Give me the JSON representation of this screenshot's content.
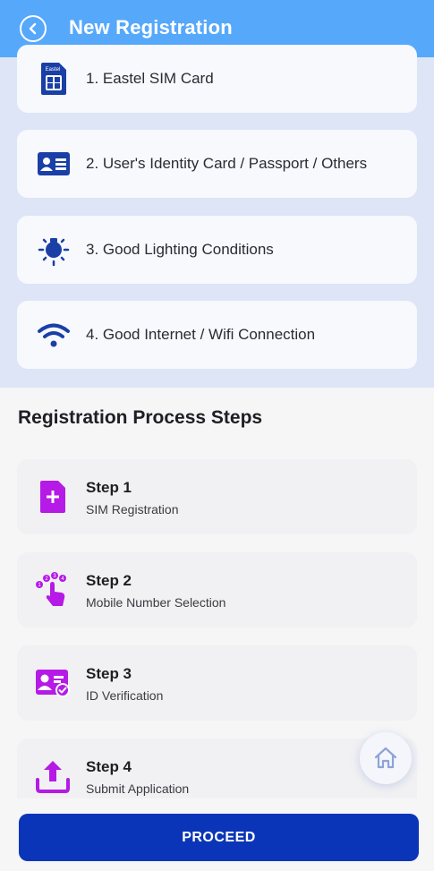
{
  "header": {
    "title": "New Registration"
  },
  "requirements": [
    {
      "label": "1. Eastel SIM Card",
      "icon": "sim-card-icon",
      "icon_text": "Eastel"
    },
    {
      "label": "2. User's Identity Card / Passport / Others",
      "icon": "id-card-icon"
    },
    {
      "label": "3. Good Lighting Conditions",
      "icon": "light-bulb-icon"
    },
    {
      "label": "4. Good Internet / Wifi Connection",
      "icon": "wifi-icon"
    }
  ],
  "steps_section": {
    "title": "Registration Process Steps",
    "steps": [
      {
        "name": "Step 1",
        "desc": "SIM Registration",
        "icon": "add-document-icon"
      },
      {
        "name": "Step 2",
        "desc": "Mobile Number Selection",
        "icon": "number-select-icon"
      },
      {
        "name": "Step 3",
        "desc": "ID Verification",
        "icon": "id-verify-icon"
      },
      {
        "name": "Step 4",
        "desc": "Submit Application",
        "icon": "upload-icon"
      }
    ]
  },
  "actions": {
    "proceed_label": "PROCEED"
  },
  "colors": {
    "header": "#56a8fb",
    "requirement_icon": "#1a3fa6",
    "step_icon": "#b51ae6",
    "proceed_button": "#0b35b8"
  }
}
